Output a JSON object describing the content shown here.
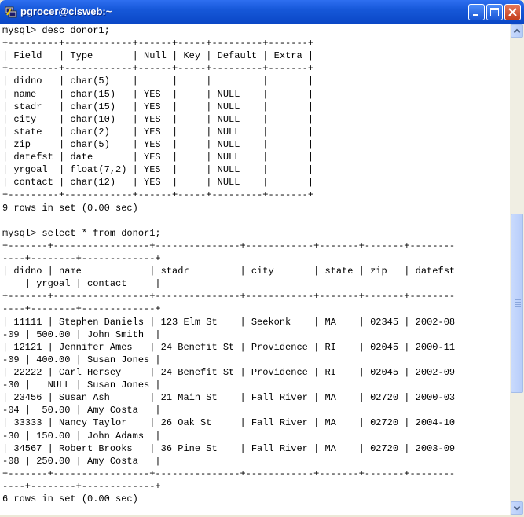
{
  "window": {
    "title": "pgrocer@cisweb:~"
  },
  "terminal": {
    "lines": [
      "mysql> desc donor1;",
      "+---------+------------+------+-----+---------+-------+",
      "| Field   | Type       | Null | Key | Default | Extra |",
      "+---------+------------+------+-----+---------+-------+",
      "| didno   | char(5)    |      |     |         |       |",
      "| name    | char(15)   | YES  |     | NULL    |       |",
      "| stadr   | char(15)   | YES  |     | NULL    |       |",
      "| city    | char(10)   | YES  |     | NULL    |       |",
      "| state   | char(2)    | YES  |     | NULL    |       |",
      "| zip     | char(5)    | YES  |     | NULL    |       |",
      "| datefst | date       | YES  |     | NULL    |       |",
      "| yrgoal  | float(7,2) | YES  |     | NULL    |       |",
      "| contact | char(12)   | YES  |     | NULL    |       |",
      "+---------+------------+------+-----+---------+-------+",
      "9 rows in set (0.00 sec)",
      "",
      "mysql> select * from donor1;",
      "+-------+-----------------+---------------+------------+-------+-------+--------",
      "----+--------+-------------+",
      "| didno | name            | stadr         | city       | state | zip   | datefst",
      "    | yrgoal | contact     |",
      "+-------+-----------------+---------------+------------+-------+-------+--------",
      "----+--------+-------------+",
      "| 11111 | Stephen Daniels | 123 Elm St    | Seekonk    | MA    | 02345 | 2002-08",
      "-09 | 500.00 | John Smith  |",
      "| 12121 | Jennifer Ames   | 24 Benefit St | Providence | RI    | 02045 | 2000-11",
      "-09 | 400.00 | Susan Jones |",
      "| 22222 | Carl Hersey     | 24 Benefit St | Providence | RI    | 02045 | 2002-09",
      "-30 |   NULL | Susan Jones |",
      "| 23456 | Susan Ash       | 21 Main St    | Fall River | MA    | 02720 | 2000-03",
      "-04 |  50.00 | Amy Costa   |",
      "| 33333 | Nancy Taylor    | 26 Oak St     | Fall River | MA    | 02720 | 2004-10",
      "-30 | 150.00 | John Adams  |",
      "| 34567 | Robert Brooks   | 36 Pine St    | Fall River | MA    | 02720 | 2003-09",
      "-08 | 250.00 | Amy Costa   |",
      "+-------+-----------------+---------------+------------+-------+-------+--------",
      "----+--------+-------------+",
      "6 rows in set (0.00 sec)"
    ]
  },
  "icons": {
    "app": "putty-icon",
    "minimize": "minimize-icon",
    "maximize": "maximize-icon",
    "close": "close-icon",
    "scroll_up": "chevron-up-icon",
    "scroll_down": "chevron-down-icon"
  },
  "colors": {
    "titlebar": "#0a47c6",
    "terminal_bg": "#ffffff",
    "terminal_fg": "#000000",
    "close_button": "#c4401d"
  },
  "scrollbar": {
    "position_fraction": 0.62
  }
}
